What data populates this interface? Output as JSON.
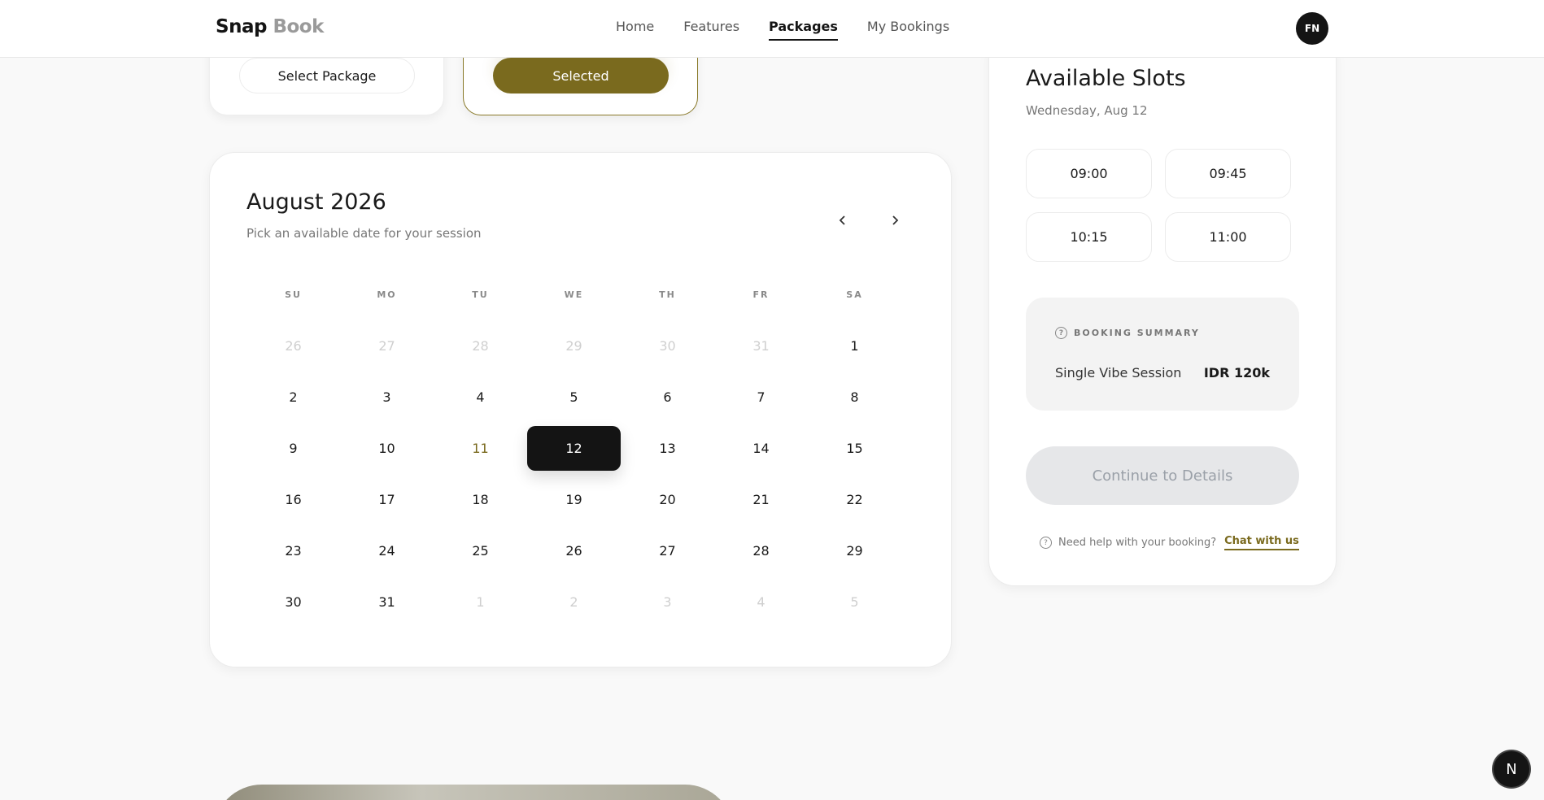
{
  "nav": {
    "logo_part1": "Snap",
    "logo_part2": "Book",
    "links": [
      "Home",
      "Features",
      "Packages",
      "My Bookings"
    ],
    "active": "Packages",
    "avatar_initials": "FN"
  },
  "packages": {
    "card1_button": "Select Package",
    "card2_button": "Selected"
  },
  "calendar": {
    "title": "August 2026",
    "subtitle": "Pick an available date for your session",
    "prev_icon": "chevron-left-icon",
    "next_icon": "chevron-right-icon",
    "weekdays": [
      "SU",
      "MO",
      "TU",
      "WE",
      "TH",
      "FR",
      "SA"
    ],
    "days": [
      {
        "d": "26",
        "s": "muted"
      },
      {
        "d": "27",
        "s": "muted"
      },
      {
        "d": "28",
        "s": "muted"
      },
      {
        "d": "29",
        "s": "muted"
      },
      {
        "d": "30",
        "s": "muted"
      },
      {
        "d": "31",
        "s": "muted"
      },
      {
        "d": "1",
        "s": ""
      },
      {
        "d": "2",
        "s": ""
      },
      {
        "d": "3",
        "s": ""
      },
      {
        "d": "4",
        "s": ""
      },
      {
        "d": "5",
        "s": ""
      },
      {
        "d": "6",
        "s": ""
      },
      {
        "d": "7",
        "s": ""
      },
      {
        "d": "8",
        "s": ""
      },
      {
        "d": "9",
        "s": ""
      },
      {
        "d": "10",
        "s": ""
      },
      {
        "d": "11",
        "s": "today"
      },
      {
        "d": "12",
        "s": "sel"
      },
      {
        "d": "13",
        "s": ""
      },
      {
        "d": "14",
        "s": ""
      },
      {
        "d": "15",
        "s": ""
      },
      {
        "d": "16",
        "s": ""
      },
      {
        "d": "17",
        "s": ""
      },
      {
        "d": "18",
        "s": ""
      },
      {
        "d": "19",
        "s": ""
      },
      {
        "d": "20",
        "s": ""
      },
      {
        "d": "21",
        "s": ""
      },
      {
        "d": "22",
        "s": ""
      },
      {
        "d": "23",
        "s": ""
      },
      {
        "d": "24",
        "s": ""
      },
      {
        "d": "25",
        "s": ""
      },
      {
        "d": "26",
        "s": ""
      },
      {
        "d": "27",
        "s": ""
      },
      {
        "d": "28",
        "s": ""
      },
      {
        "d": "29",
        "s": ""
      },
      {
        "d": "30",
        "s": ""
      },
      {
        "d": "31",
        "s": ""
      },
      {
        "d": "1",
        "s": "muted"
      },
      {
        "d": "2",
        "s": "muted"
      },
      {
        "d": "3",
        "s": "muted"
      },
      {
        "d": "4",
        "s": "muted"
      },
      {
        "d": "5",
        "s": "muted"
      }
    ]
  },
  "slots": {
    "title": "Available Slots",
    "date": "Wednesday, Aug 12",
    "times": [
      "09:00",
      "09:45",
      "10:15",
      "11:00"
    ]
  },
  "summary": {
    "heading": "BOOKING SUMMARY",
    "icon": "question-circle-icon",
    "item": "Single Vibe Session",
    "price": "IDR 120k"
  },
  "cta": {
    "continue_label": "Continue to Details"
  },
  "help": {
    "text": "Need help with your booking?",
    "link": "Chat with us"
  },
  "floating": {
    "label": "N"
  },
  "colors": {
    "accent": "#7a6a1e",
    "dark": "#141414"
  }
}
